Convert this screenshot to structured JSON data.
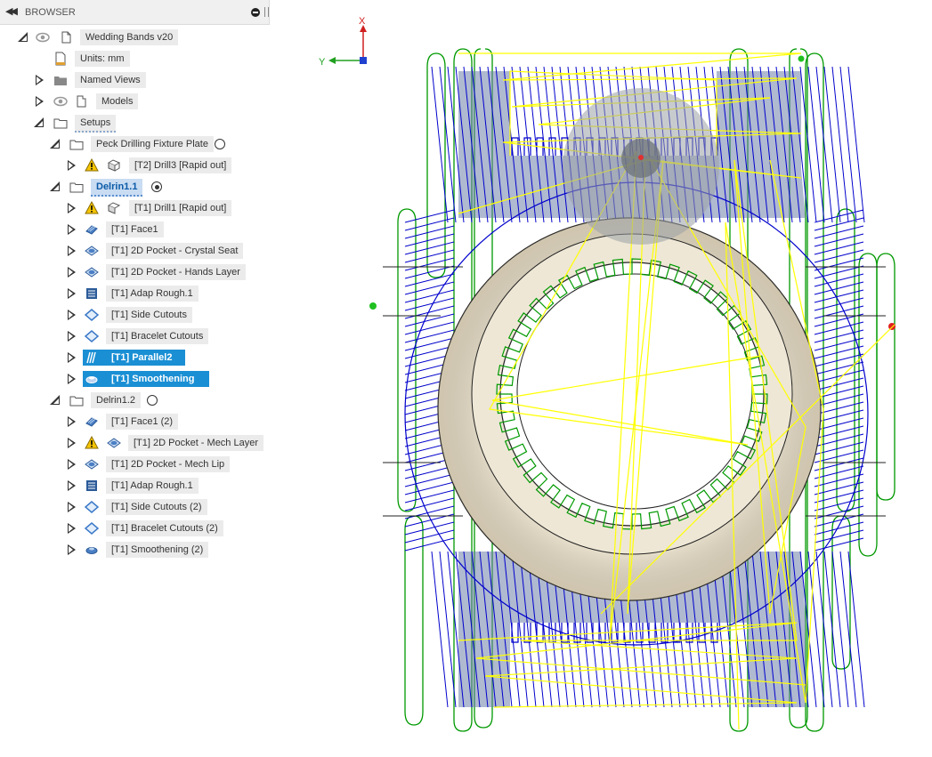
{
  "browser": {
    "title": "BROWSER",
    "tree": {
      "root": "Wedding Bands v20",
      "units": "Units: mm",
      "named_views": "Named Views",
      "models": "Models",
      "setups": "Setups",
      "setup1": {
        "name": "Peck Drilling Fixture Plate",
        "ops": [
          "[T2] Drill3 [Rapid out]"
        ]
      },
      "setup2": {
        "name": "Delrin1.1",
        "ops": [
          "[T1] Drill1 [Rapid out]",
          "[T1] Face1",
          "[T1] 2D Pocket - Crystal Seat",
          "[T1] 2D Pocket - Hands Layer",
          "[T1] Adap Rough.1",
          "[T1] Side Cutouts",
          "[T1] Bracelet Cutouts",
          "[T1] Parallel2",
          "[T1] Smoothening"
        ]
      },
      "setup3": {
        "name": "Delrin1.2",
        "ops": [
          "[T1] Face1 (2)",
          "[T1] 2D Pocket - Mech Layer",
          "[T1] 2D Pocket - Mech Lip",
          "[T1] Adap Rough.1",
          "[T1] Side Cutouts (2)",
          "[T1] Bracelet Cutouts (2)",
          "[T1] Smoothening (2)"
        ]
      }
    }
  },
  "viewport": {
    "triad": {
      "x": "X",
      "y": "Y"
    }
  },
  "colors": {
    "selection": "#1a8fd4",
    "rapid": "#ffff00",
    "cut": "#0000cc",
    "lead": "#009900",
    "stock": "#e8e0cc"
  }
}
